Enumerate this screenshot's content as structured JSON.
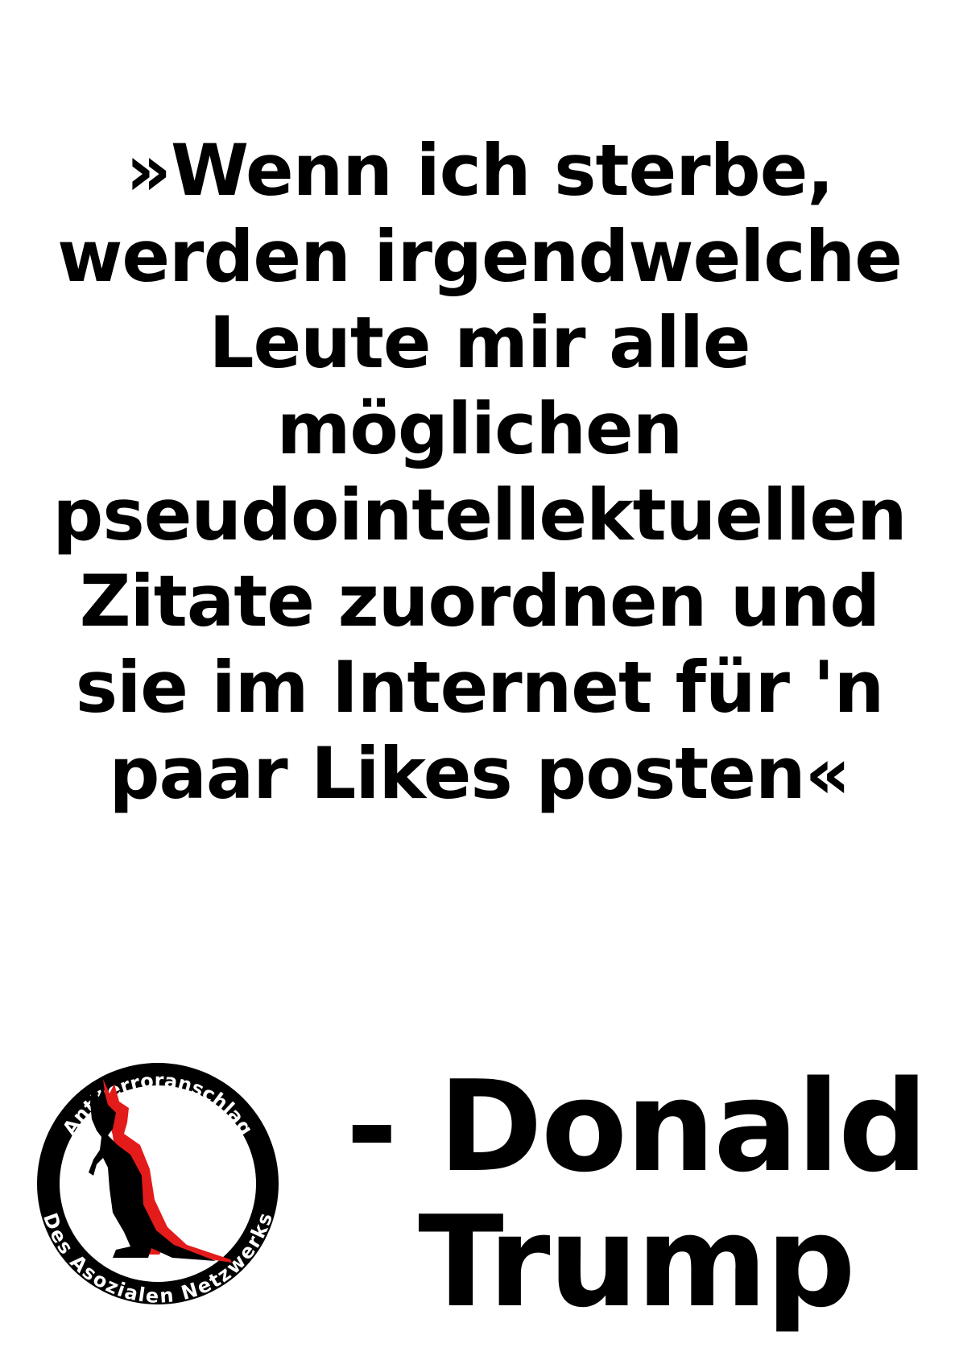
{
  "quote": {
    "lines": [
      "»Wenn ich sterbe,",
      "werden irgendwelche",
      "Leute mir alle",
      "möglichen",
      "pseudointellektuellen",
      "Zitate zuordnen und",
      "sie im Internet für 'n",
      "paar Likes posten«"
    ]
  },
  "author": {
    "lines": [
      "- Donald",
      "Trump"
    ]
  },
  "logo": {
    "top_text": "Antiterroranschlag",
    "bottom_text": "Des Asozialen Netzwerks",
    "colors": {
      "ring": "#000000",
      "text": "#ffffff",
      "kangaroo": "#000000",
      "shadow": "#e31b1b"
    }
  }
}
